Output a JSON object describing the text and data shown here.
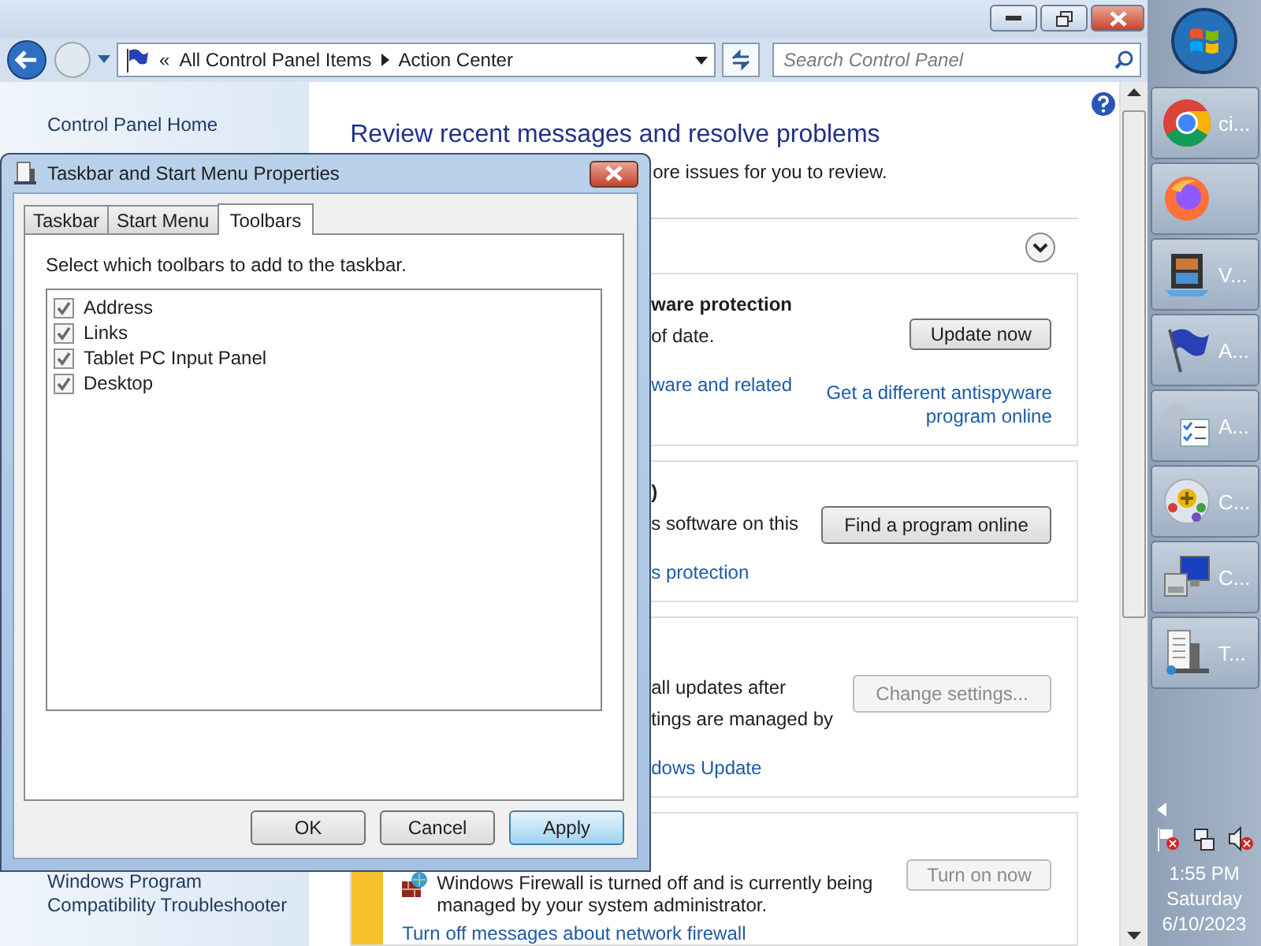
{
  "address_bar": {
    "overflow_mark": "«",
    "breadcrumbs": [
      "All Control Panel Items",
      "Action Center"
    ]
  },
  "search": {
    "placeholder": "Search Control Panel"
  },
  "sidebar": {
    "items": [
      {
        "label": "Control Panel Home"
      },
      {
        "label": "Windows Program Compatibility Troubleshooter"
      }
    ]
  },
  "main": {
    "heading": "Review recent messages and resolve problems",
    "intro": "ore issues for you to review.",
    "sections": [
      {
        "kind": "message",
        "title": "ware protection",
        "lines": [
          "of date."
        ],
        "link": "ware and related",
        "button": {
          "label": "Update now",
          "disabled": false
        },
        "side_link": "Get a different antispyware program online"
      },
      {
        "kind": "message",
        "title": ")",
        "lines": [
          "s software on this"
        ],
        "link": "s protection",
        "button": {
          "label": "Find a program online",
          "disabled": false
        }
      },
      {
        "kind": "message",
        "lines": [
          "all updates after",
          "tings are managed by"
        ],
        "link": "dows Update",
        "button": {
          "label": "Change settings...",
          "disabled": true
        }
      },
      {
        "kind": "warning",
        "message": "Windows Firewall is turned off and is currently being managed by your system administrator.",
        "link": "Turn off messages about network firewall",
        "button": {
          "label": "Turn on now",
          "disabled": true
        }
      }
    ]
  },
  "dialog": {
    "title": "Taskbar and Start Menu Properties",
    "tabs": [
      {
        "label": "Taskbar",
        "selected": false
      },
      {
        "label": "Start Menu",
        "selected": false
      },
      {
        "label": "Toolbars",
        "selected": true
      }
    ],
    "instruction": "Select which toolbars to add to the taskbar.",
    "toolbars": [
      {
        "label": "Address",
        "checked": true
      },
      {
        "label": "Links",
        "checked": true
      },
      {
        "label": "Tablet PC Input Panel",
        "checked": true
      },
      {
        "label": "Desktop",
        "checked": true
      }
    ],
    "buttons": [
      {
        "label": "OK",
        "hot": false
      },
      {
        "label": "Cancel",
        "hot": false
      },
      {
        "label": "Apply",
        "hot": true
      }
    ]
  },
  "taskbar": {
    "apps": [
      {
        "kind": "chrome",
        "label": "ci..."
      },
      {
        "kind": "firefox"
      },
      {
        "kind": "video",
        "label": "V..."
      },
      {
        "kind": "flag",
        "label": "A..."
      },
      {
        "kind": "checklist",
        "label": "A..."
      },
      {
        "kind": "orb",
        "label": "C..."
      },
      {
        "kind": "computer",
        "label": "C..."
      },
      {
        "kind": "server",
        "label": "T..."
      }
    ],
    "clock": {
      "time": "1:55 PM",
      "day": "Saturday",
      "date": "6/10/2023"
    }
  }
}
